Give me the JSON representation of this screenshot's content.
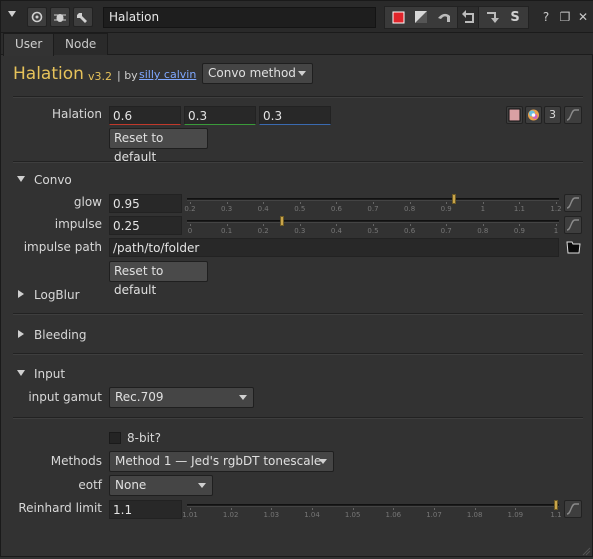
{
  "titlebar": {
    "node_name": "Halation",
    "icons": [
      "collapse-arrow-icon",
      "circle-icon",
      "bug-icon",
      "wrench-icon",
      "color-swatch-icon",
      "pen-icon",
      "undo-icon",
      "redo-icon",
      "settings-s-icon",
      "help-icon",
      "float-icon",
      "close-icon"
    ],
    "help_glyph": "?",
    "float_glyph": "❐",
    "close_glyph": "✕",
    "s_glyph": "S",
    "accent_red": "#e0252b"
  },
  "tabs": [
    {
      "label": "User",
      "active": true
    },
    {
      "label": "Node",
      "active": false
    }
  ],
  "header": {
    "title": "Halation",
    "version": "v3.2",
    "by_text": "| by",
    "author": "silly calvin",
    "method_dropdown": "Convo method",
    "title_color": "#e6c25a",
    "link_color": "#7fa8ff"
  },
  "halation": {
    "label": "Halation",
    "values": [
      "0.6",
      "0.3",
      "0.3"
    ],
    "underline_colors": [
      "#c0392b",
      "#3a9a3a",
      "#3a6ab0"
    ],
    "channel_count": "3",
    "reset_label": "Reset to default"
  },
  "convo": {
    "section_label": "Convo",
    "glow": {
      "label": "glow",
      "value": "0.95",
      "ticks": [
        "0.2",
        "0.3",
        "0.4",
        "0.5",
        "0.6",
        "0.7",
        "0.8",
        "0.9",
        "1",
        "1.1",
        "1.2"
      ],
      "handle_fraction": 0.72
    },
    "impulse": {
      "label": "impulse",
      "value": "0.25",
      "ticks": [
        "0",
        "0.1",
        "0.2",
        "0.3",
        "0.4",
        "0.5",
        "0.6",
        "0.7",
        "0.8",
        "0.9",
        "1"
      ],
      "handle_fraction": 0.25
    },
    "impulse_path": {
      "label": "impulse path",
      "value": "/path/to/folder"
    },
    "reset_label": "Reset to default"
  },
  "sections": {
    "logblur": "LogBlur",
    "bleeding": "Bleeding",
    "input": "Input"
  },
  "input": {
    "gamut_label": "input gamut",
    "gamut_value": "Rec.709"
  },
  "output": {
    "eightbit_label": "8-bit?",
    "methods_label": "Methods",
    "methods_value": "Method 1 — Jed's rgbDT tonescale",
    "eotf_label": "eotf",
    "eotf_value": "None",
    "reinhard_label": "Reinhard limit",
    "reinhard_value": "1.1",
    "reinhard_ticks": [
      "1.01",
      "1.02",
      "1.03",
      "1.04",
      "1.05",
      "1.06",
      "1.07",
      "1.08",
      "1.09",
      "1.1"
    ],
    "reinhard_handle_fraction": 1.0
  }
}
